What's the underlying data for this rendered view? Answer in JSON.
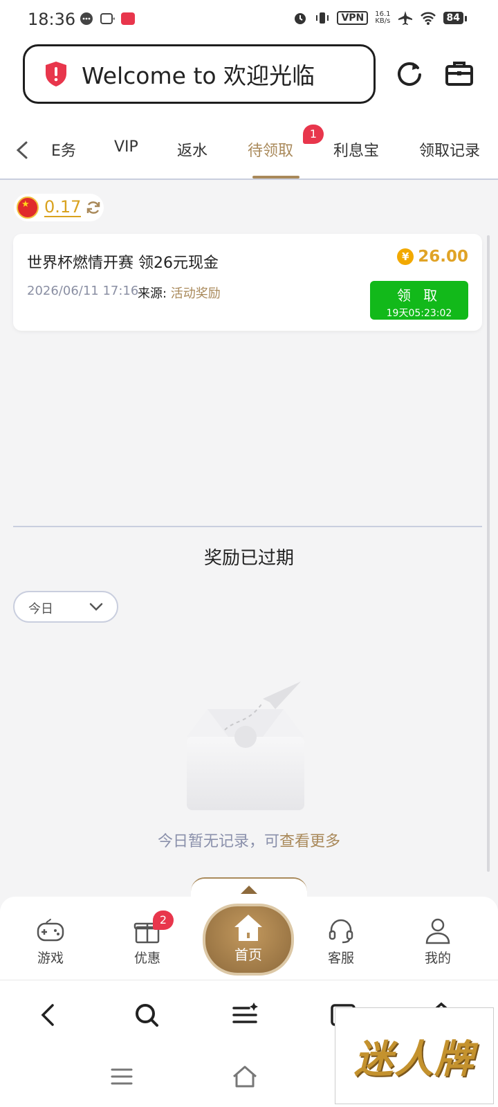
{
  "status_bar": {
    "time": "18:36",
    "vpn": "VPN",
    "speed_value": "16.1",
    "speed_unit": "KB/s",
    "battery": "84"
  },
  "header": {
    "welcome_text": "Welcome to 欢迎光临"
  },
  "tabs": {
    "items": [
      "E务",
      "VIP",
      "返水",
      "待领取",
      "利息宝",
      "领取记录"
    ],
    "active_index": 3,
    "badge": "1"
  },
  "balance": {
    "value": "0.17"
  },
  "reward": {
    "title": "世界杯燃情开赛 领26元现金",
    "amount": "26.00",
    "currency_symbol": "¥",
    "date": "2026/06/11 17:16",
    "source_label": "来源: ",
    "source_value": "活动奖励",
    "claim_label": "领 取",
    "claim_timer": "19天05:23:02"
  },
  "expired": {
    "title": "奖励已过期",
    "filter_value": "今日",
    "empty_text": "今日暂无记录，可",
    "empty_link": "查看更多"
  },
  "bottom_nav": {
    "games": "游戏",
    "promotions": "优惠",
    "promotions_badge": "2",
    "home": "首页",
    "support": "客服",
    "profile": "我的"
  },
  "watermark": "迷人牌",
  "colors": {
    "gold_accent": "#a9895a",
    "amount_gold": "#e0a326",
    "claim_green": "#12b91a",
    "badge_red": "#e8364c",
    "divider": "#c9cede"
  }
}
